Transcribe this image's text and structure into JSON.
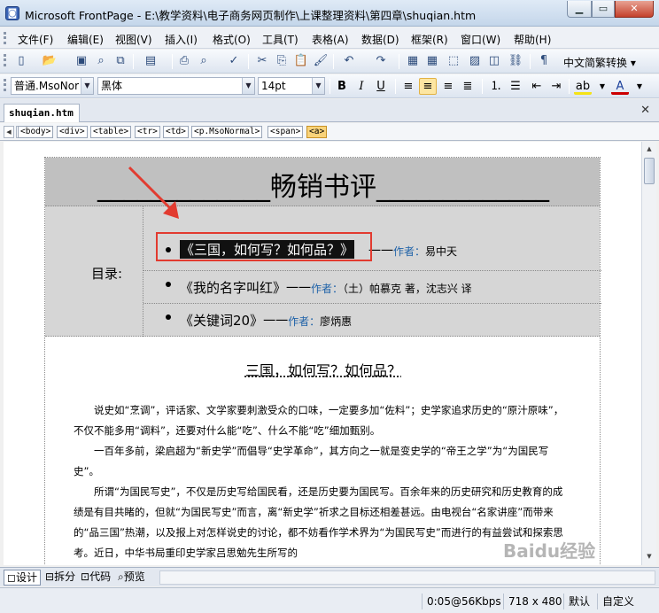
{
  "window": {
    "title": "Microsoft FrontPage - E:\\教学资料\\电子商务网页制作\\上课整理资料\\第四章\\shuqian.htm"
  },
  "menu": [
    "文件(F)",
    "编辑(E)",
    "视图(V)",
    "插入(I)",
    "格式(O)",
    "工具(T)",
    "表格(A)",
    "数据(D)",
    "框架(R)",
    "窗口(W)",
    "帮助(H)"
  ],
  "toolbar": {
    "language": "中文简繁转换 ▾"
  },
  "format": {
    "style": "普通.MsoNor",
    "font": "黑体",
    "size": "14pt"
  },
  "doc_tab": "shuqian.htm",
  "tags": [
    "<body>",
    "<div>",
    "<table>",
    "<tr>",
    "<td>",
    "<p.MsoNormal>",
    "<span>",
    "<a>"
  ],
  "page": {
    "title": "_____________畅销书评_____________",
    "toc_label": "目录:",
    "toc": [
      {
        "title": "《三国，如何写？如何品？》",
        "dash": "一一",
        "author_label": "作者：",
        "author": "易中天"
      },
      {
        "title": "《我的名字叫红》",
        "dash": "一一",
        "author_label": "作者：",
        "author": "（土）帕慕克 著，沈志兴 译"
      },
      {
        "title": "《关键词20》",
        "dash": "一一",
        "author_label": "作者：",
        "author": "廖炳惠"
      }
    ],
    "article_title": "三国，如何写？如何品？",
    "paragraphs": [
      "　　说史如“烹调”，评话家、文学家要刺激受众的口味，一定要多加“佐料”；史学家追求历史的“原汁原味”，不仅不能多用“调料”，还要对什么能“吃”、什么不能“吃”细加甄别。",
      "　　一百年多前，梁启超为“新史学”而倡导“史学革命”，其方向之一就是变史学的“帝王之学”为“为国民写史”。",
      "　　所谓“为国民写史”，不仅是历史写给国民看，还是历史要为国民写。百余年来的历史研究和历史教育的成绩是有目共睹的，但就“为国民写史”而言，离“新史学”祈求之目标还相差甚远。由电视台“名家讲座”而带来的“品三国”热潮，以及报上对怎样说史的讨论，都不妨看作学术界为“为国民写史”而进行的有益尝试和探索思考。近日，中华书局重印史学家吕思勉先生所写的"
    ]
  },
  "views": [
    "设计",
    "拆分",
    "代码",
    "预览"
  ],
  "status": {
    "speed": "0:05@56Kbps",
    "size": "718 x 480",
    "default": "默认",
    "custom": "自定义"
  },
  "watermark": "Baidu经验"
}
